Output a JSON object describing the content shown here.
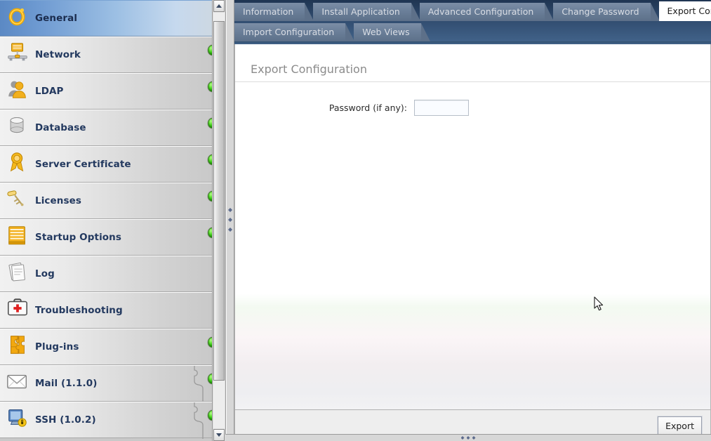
{
  "sidebar": {
    "items": [
      {
        "label": "General",
        "icon": "ring-icon",
        "selected": true,
        "led": false,
        "plugin": false
      },
      {
        "label": "Network",
        "icon": "network-icon",
        "selected": false,
        "led": true,
        "plugin": false
      },
      {
        "label": "LDAP",
        "icon": "users-icon",
        "selected": false,
        "led": true,
        "plugin": false
      },
      {
        "label": "Database",
        "icon": "database-icon",
        "selected": false,
        "led": true,
        "plugin": false
      },
      {
        "label": "Server Certificate",
        "icon": "certificate-icon",
        "selected": false,
        "led": true,
        "plugin": false
      },
      {
        "label": "Licenses",
        "icon": "key-icon",
        "selected": false,
        "led": true,
        "plugin": false
      },
      {
        "label": "Startup Options",
        "icon": "drawer-icon",
        "selected": false,
        "led": true,
        "plugin": false
      },
      {
        "label": "Log",
        "icon": "documents-icon",
        "selected": false,
        "led": false,
        "plugin": false
      },
      {
        "label": "Troubleshooting",
        "icon": "first-aid-kit-icon",
        "selected": false,
        "led": false,
        "plugin": false
      },
      {
        "label": "Plug-ins",
        "icon": "puzzle-piece-icon",
        "selected": false,
        "led": true,
        "plugin": false
      },
      {
        "label": "Mail (1.1.0)",
        "icon": "mail-envelope-icon",
        "selected": false,
        "led": true,
        "plugin": true
      },
      {
        "label": "SSH (1.0.2)",
        "icon": "ssh-terminal-icon",
        "selected": false,
        "led": true,
        "plugin": true
      }
    ],
    "scrollbar": {
      "up_icon": "scroll-up-arrow-icon",
      "down_icon": "scroll-down-arrow-icon"
    }
  },
  "tabs": {
    "row1": [
      {
        "label": "Information",
        "active": false
      },
      {
        "label": "Install Application",
        "active": false
      },
      {
        "label": "Advanced Configuration",
        "active": false
      },
      {
        "label": "Change Password",
        "active": false
      },
      {
        "label": "Export Configuration",
        "active": true
      }
    ],
    "row2": [
      {
        "label": "Import Configuration",
        "active": false
      },
      {
        "label": "Web Views",
        "active": false
      }
    ]
  },
  "pane": {
    "title": "Export Configuration",
    "password_label": "Password (if any):",
    "password_value": "",
    "password_placeholder": ""
  },
  "footer": {
    "export_label": "Export"
  },
  "colors": {
    "tab_bar": "#2f4a6d",
    "tab_inactive": "#6b7f99",
    "tab_active": "#ffffff",
    "sidebar_selected": "#6f9bd2",
    "label_text": "#23395f",
    "pane_title_text": "#8b8b8b",
    "led_green": "#17a800"
  }
}
